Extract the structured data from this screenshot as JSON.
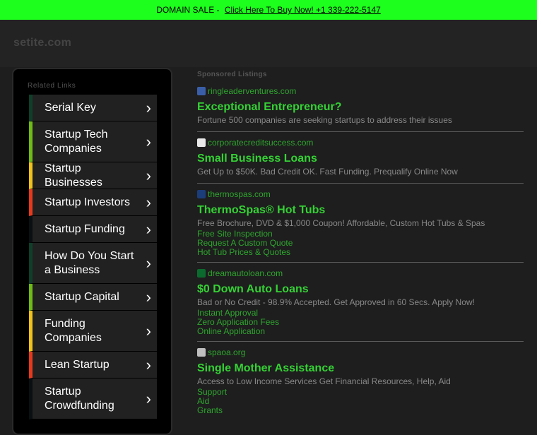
{
  "topbar": {
    "prefix": "DOMAIN SALE -",
    "link": "Click Here To Buy Now! +1 339-222-5147"
  },
  "site": {
    "name": "setite.com"
  },
  "sidebar": {
    "title": "Related Links",
    "items": [
      {
        "label": "Serial Key",
        "accent": "#0f3f2a"
      },
      {
        "label": "Startup Tech Companies",
        "accent": "#6fbb16"
      },
      {
        "label": "Startup Businesses",
        "accent": "#f0c21a"
      },
      {
        "label": "Startup Investors",
        "accent": "#e8381c"
      },
      {
        "label": "Startup Funding",
        "accent": "#0a0f12"
      },
      {
        "label": "How Do You Start a Business",
        "accent": "#0f3f2a"
      },
      {
        "label": "Startup Capital",
        "accent": "#6fbb16"
      },
      {
        "label": "Funding Companies",
        "accent": "#f0c21a"
      },
      {
        "label": "Lean Startup",
        "accent": "#e8381c"
      },
      {
        "label": "Startup Crowdfunding",
        "accent": "#0a0f12"
      }
    ]
  },
  "main": {
    "sponsored_label": "Sponsored Listings",
    "listings": [
      {
        "domain": "ringleaderventures.com",
        "icon": "ringleader-favicon",
        "title": "Exceptional Entrepreneur?",
        "desc": "Fortune 500 companies are seeking startups to address their issues",
        "links": []
      },
      {
        "domain": "corporatecreditsuccess.com",
        "icon": "globe-favicon",
        "title": "Small Business Loans",
        "desc": "Get Up to $50K. Bad Credit OK. Fast Funding. Prequalify Online Now",
        "links": []
      },
      {
        "domain": "thermospas.com",
        "icon": "thermospas-favicon",
        "title": "ThermoSpas® Hot Tubs",
        "desc": "Free Brochure, DVD & $1,000 Coupon! Affordable, Custom Hot Tubs & Spas",
        "links": [
          "Free Site Inspection",
          "Request A Custom Quote",
          "Hot Tub Prices & Quotes"
        ]
      },
      {
        "domain": "dreamautoloan.com",
        "icon": "dreamauto-favicon",
        "title": "$0 Down Auto Loans",
        "desc": "Bad or No Credit - 98.9% Accepted. Get Approved in 60 Secs. Apply Now!",
        "links": [
          "Instant Approval",
          "Zero Application Fees",
          "Online Application"
        ]
      },
      {
        "domain": "spaoa.org",
        "icon": "spaoa-favicon",
        "title": "Single Mother Assistance",
        "desc": "Access to Low Income Services Get Financial Resources, Help, Aid",
        "links": [
          "Support",
          "Aid",
          "Grants"
        ]
      }
    ]
  }
}
